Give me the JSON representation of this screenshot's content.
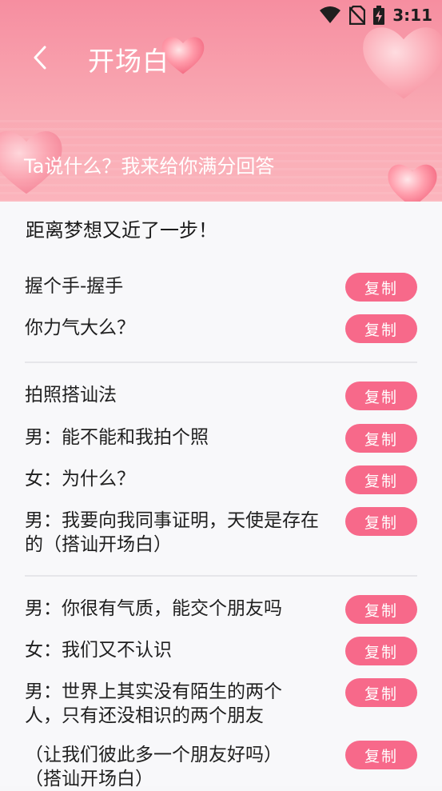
{
  "status_bar": {
    "time": "3:11",
    "icons": [
      "wifi-icon",
      "no-sim-icon",
      "battery-charging-icon"
    ]
  },
  "header": {
    "title": "开场白",
    "subtitle": "Ta说什么？我来给你满分回答",
    "back_icon": "chevron-left-icon"
  },
  "intro": "距离梦想又近了一步！",
  "copy_label": "复制",
  "groups": [
    {
      "lines": [
        "握个手-握手",
        "你力气大么？"
      ]
    },
    {
      "lines": [
        "拍照搭讪法",
        "男：能不能和我拍个照",
        "女：为什么？",
        "男：我要向我同事证明，天使是存在的（搭讪开场白）"
      ]
    },
    {
      "lines": [
        "男：你很有气质，能交个朋友吗",
        "女：我们又不认识",
        "男：世界上其实没有陌生的两个人，只有还没相识的两个朋友",
        "（让我们彼此多一个朋友好吗）（搭讪开场白）"
      ]
    }
  ],
  "colors": {
    "accent": "#f7698a",
    "header_top": "#f68ea0",
    "header_bottom": "#fbb4bc"
  }
}
